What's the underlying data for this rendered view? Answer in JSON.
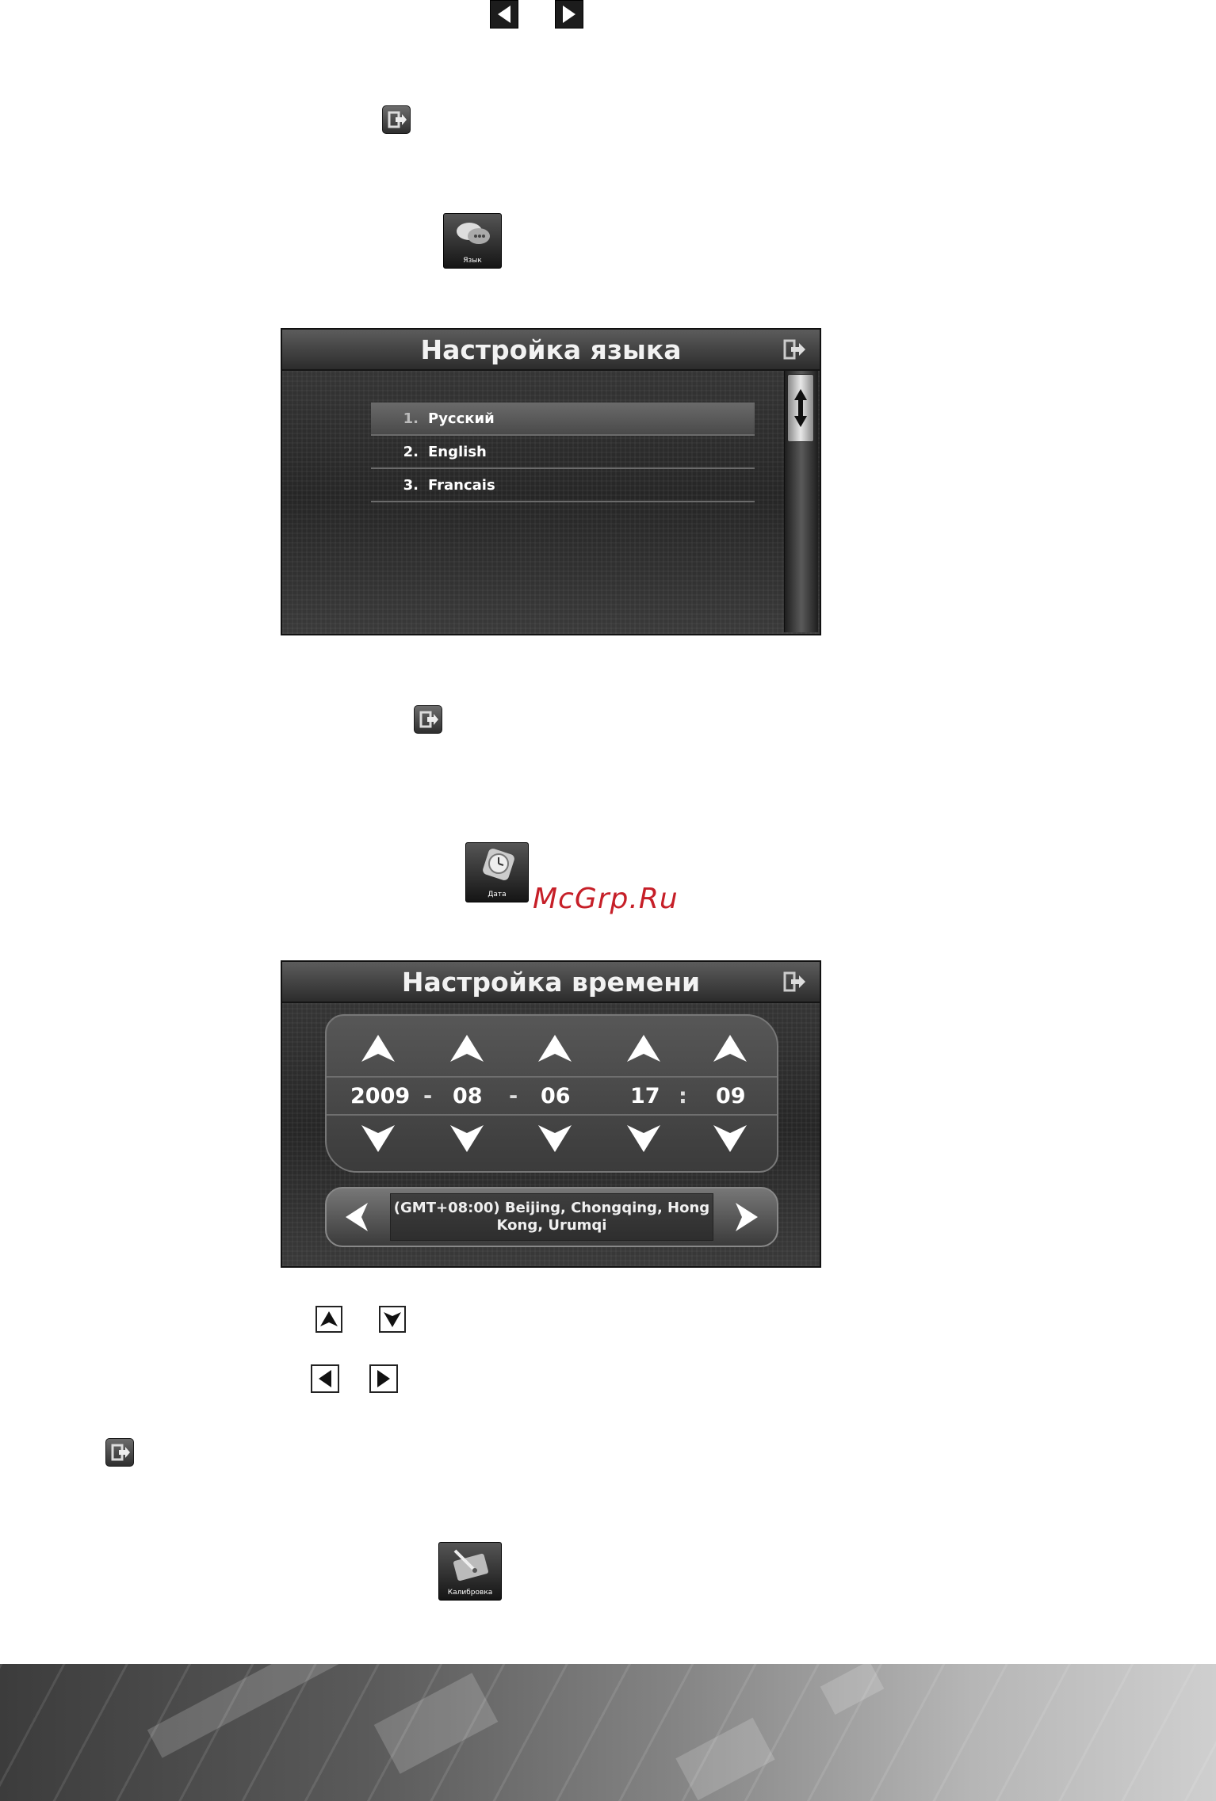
{
  "language_panel": {
    "title": "Настройка языка",
    "items": [
      {
        "num": "1.",
        "label": "Русский"
      },
      {
        "num": "2.",
        "label": "English"
      },
      {
        "num": "3.",
        "label": "Francais"
      }
    ]
  },
  "time_panel": {
    "title": "Настройка времени",
    "year": "2009",
    "month": "08",
    "day": "06",
    "hour": "17",
    "minute": "09",
    "date_sep": "-",
    "time_sep": ":",
    "timezone": "(GMT+08:00) Beijing, Chongqing, Hong Kong, Urumqi"
  },
  "menu_icons": {
    "language": "Язык",
    "date": "Дата",
    "calibration": "Калибровка"
  },
  "watermark": "McGrp.Ru",
  "icons": [
    "left-arrow-icon",
    "right-arrow-icon",
    "exit-icon",
    "up-arrow-icon",
    "down-arrow-icon",
    "scroll-icon"
  ]
}
